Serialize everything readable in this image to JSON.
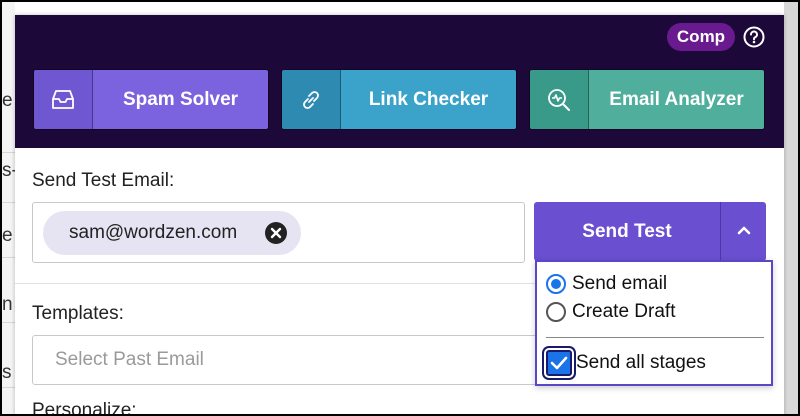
{
  "background": {
    "left_fragments": [
      "e",
      "s-",
      "e",
      "n",
      "e",
      "s",
      "n"
    ]
  },
  "header": {
    "badge_label": "Comp",
    "help_icon": "help-circle-icon",
    "tools": [
      {
        "label": "Spam Solver",
        "icon": "inbox-tray-icon",
        "color": "#7b63e0"
      },
      {
        "label": "Link Checker",
        "icon": "link-icon",
        "color": "#3ba3c9"
      },
      {
        "label": "Email Analyzer",
        "icon": "magnifier-chart-icon",
        "color": "#4fae9c"
      }
    ]
  },
  "send_test": {
    "label": "Send Test Email:",
    "recipient_chip": "sam@wordzen.com",
    "button_label": "Send Test",
    "menu": {
      "option_send_email": "Send email",
      "option_create_draft": "Create Draft",
      "selected": "Send email",
      "send_all_stages_label": "Send all stages",
      "send_all_stages_checked": true
    }
  },
  "templates": {
    "label": "Templates:",
    "placeholder": "Select Past Email"
  },
  "personalize": {
    "label": "Personalize:"
  },
  "colors": {
    "header_bg": "#1d0939",
    "accent": "#6a4fd0",
    "badge": "#6a1a8f"
  }
}
